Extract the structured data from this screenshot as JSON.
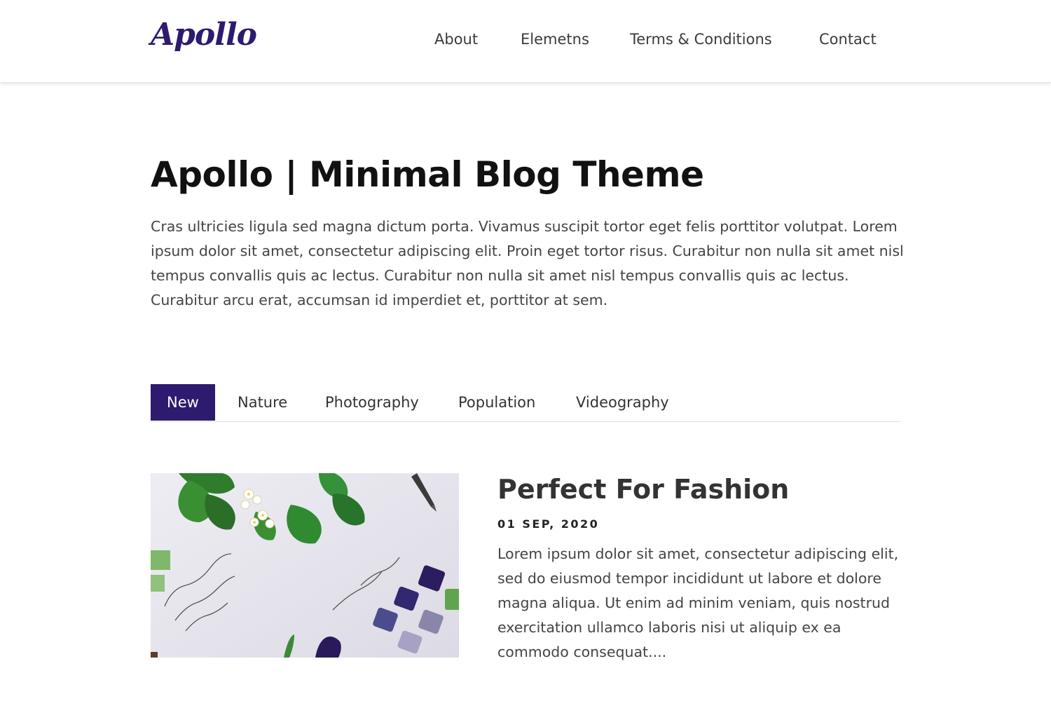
{
  "header": {
    "logo": "Apollo",
    "nav": [
      "About",
      "Elemetns",
      "Terms & Conditions",
      "Contact"
    ]
  },
  "hero": {
    "title": "Apollo | Minimal Blog Theme",
    "text": "Cras ultricies ligula sed magna dictum porta. Vivamus suscipit tortor eget felis porttitor volutpat. Lorem ipsum dolor sit amet, consectetur adipiscing elit. Proin eget tortor risus. Curabitur non nulla sit amet nisl tempus convallis quis ac lectus. Curabitur non nulla sit amet nisl tempus convallis quis ac lectus. Curabitur arcu erat, accumsan id imperdiet et, porttitor at sem."
  },
  "tabs": [
    "New",
    "Nature",
    "Photography",
    "Population",
    "Videography"
  ],
  "active_tab": "New",
  "post": {
    "title": "Perfect For Fashion",
    "date": "01 SEP, 2020",
    "excerpt": "Lorem ipsum dolor sit amet, consectetur adipiscing elit, sed do eiusmod tempor incididunt ut labore et dolore magna aliqua. Ut enim ad minim veniam, quis nostrud exercitation ullamco laboris nisi ut aliquip ex ea commodo consequat...."
  },
  "colors": {
    "accent": "#2e1a6e",
    "text": "#444444",
    "heading": "#111111"
  }
}
